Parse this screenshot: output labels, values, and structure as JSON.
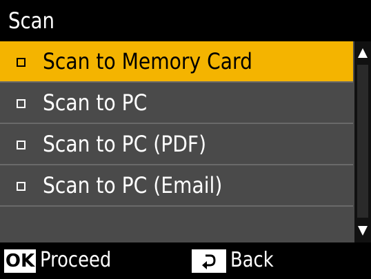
{
  "header": {
    "title": "Scan"
  },
  "menu": {
    "items": [
      {
        "label": "Scan to Memory Card",
        "selected": true
      },
      {
        "label": "Scan to PC",
        "selected": false
      },
      {
        "label": "Scan to PC (PDF)",
        "selected": false
      },
      {
        "label": "Scan to PC (Email)",
        "selected": false
      }
    ]
  },
  "scrollbar": {
    "up_icon": "triangle-up-icon",
    "down_icon": "triangle-down-icon"
  },
  "footer": {
    "ok_key": "OK",
    "proceed_label": "Proceed",
    "back_icon": "back-arrow-icon",
    "back_label": "Back"
  },
  "colors": {
    "selected_row": "#f4b400",
    "row_background": "#4a4a4a",
    "header_footer_background": "#000000",
    "text_light": "#ffffff",
    "text_dark": "#000000"
  }
}
